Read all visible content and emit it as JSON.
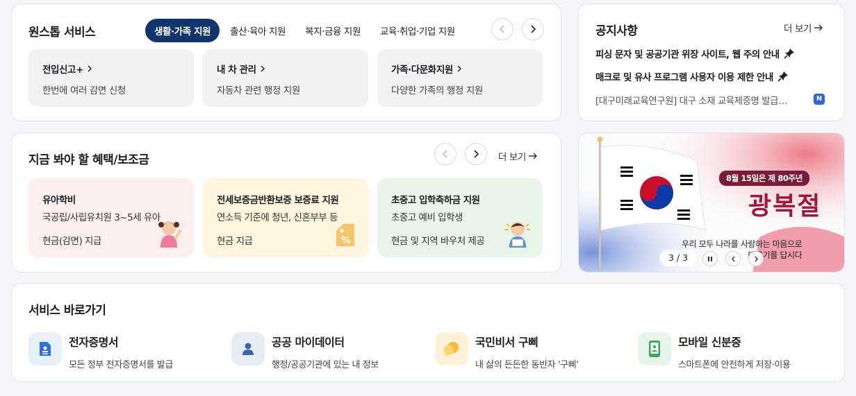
{
  "onestop": {
    "title": "원스톱 서비스",
    "tabs": [
      {
        "label": "생활·가족 지원",
        "active": true
      },
      {
        "label": "출산·육아 지원",
        "active": false
      },
      {
        "label": "복지·금융 지원",
        "active": false
      },
      {
        "label": "교육·취업·기업 지원",
        "active": false
      }
    ],
    "services": [
      {
        "title": "전입신고+",
        "desc": "한번에 여러 감면 신청"
      },
      {
        "title": "내 차 관리",
        "desc": "자동차 관련 행정 지원"
      },
      {
        "title": "가족·다문화지원",
        "desc": "다양한 가족의 행정 지원"
      }
    ]
  },
  "notice": {
    "title": "공지사항",
    "more": "더 보기",
    "items": [
      {
        "text": "피싱 문자 및 공공기관 위장 사이트, 웹 주의 안내",
        "pinned": true
      },
      {
        "text": "매크로 및 유사 프로그램 사용자 이용 제한 안내",
        "pinned": true
      },
      {
        "text": "[대구미래교육연구원] 대구 소재 교육제증명 발급…",
        "badge": "N"
      }
    ]
  },
  "benefit": {
    "title": "지금 봐야 할 혜택/보조금",
    "more": "더 보기",
    "cards": [
      {
        "title": "유아학비",
        "line1": "국공립/사립유치원 3~5세 유아",
        "line2": "현금(감면) 지급",
        "bg": "#fdeef0"
      },
      {
        "title": "전세보증금반환보증 보증료 지원",
        "line1": "연소득 기준에 청년, 신혼부부 등",
        "line2": "현금 지급",
        "bg": "#fff4de"
      },
      {
        "title": "초중고 입학축하금 지원",
        "line1": "초중고 예비 입학생",
        "line2": "현금 및 지역 바우처 제공",
        "bg": "#e9f5ea"
      }
    ]
  },
  "banner": {
    "tag": "8월 15일은 제 80주년",
    "headline": "광복절",
    "sub1": "우리 모두 나라를 사랑하는 마음으로",
    "sub2": "태극기를 답시다",
    "counter": "3 / 3"
  },
  "shortcut": {
    "title": "서비스 바로가기",
    "items": [
      {
        "title": "전자증명서",
        "desc": "모든 정부 전자증명서를 발급",
        "icon": "document-icon"
      },
      {
        "title": "공공 마이데이터",
        "desc": "행정/공공기관에 있는 내 정보",
        "icon": "person-icon"
      },
      {
        "title": "국민비서 구삐",
        "desc": "내 삶의 든든한 동반자 '구삐'",
        "icon": "chat-icon"
      },
      {
        "title": "모바일 신분증",
        "desc": "스마트폰에 안전하게 저장·이용",
        "icon": "mobile-id-icon"
      }
    ]
  }
}
